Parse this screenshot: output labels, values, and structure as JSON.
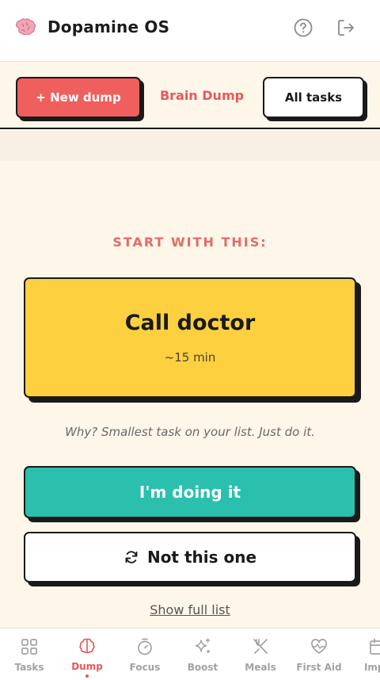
{
  "header": {
    "title": "Dopamine OS",
    "brand_icon": "brain-icon",
    "help_icon": "help-circle-icon",
    "logout_icon": "logout-icon"
  },
  "toolbar": {
    "new_dump_label": "+ New dump",
    "section_label": "Brain Dump",
    "all_tasks_label": "All tasks"
  },
  "main": {
    "prompt": "START WITH THIS:",
    "task": {
      "title": "Call doctor",
      "duration": "~15 min"
    },
    "reason": "Why? Smallest task on your list. Just do it.",
    "doing_label": "I'm doing it",
    "skip_label": "Not this one",
    "show_list_label": "Show full list"
  },
  "nav": {
    "items": [
      {
        "label": "Tasks",
        "icon": "grid-icon",
        "active": false
      },
      {
        "label": "Dump",
        "icon": "brain-icon",
        "active": true
      },
      {
        "label": "Focus",
        "icon": "timer-icon",
        "active": false
      },
      {
        "label": "Boost",
        "icon": "sparkle-icon",
        "active": false
      },
      {
        "label": "Meals",
        "icon": "utensils-icon",
        "active": false
      },
      {
        "label": "First Aid",
        "icon": "heart-pulse-icon",
        "active": false
      },
      {
        "label": "Impu",
        "icon": "calendar-icon",
        "active": false
      }
    ]
  },
  "colors": {
    "accent": "#ef5f5d",
    "card": "#fdd040",
    "primary_action": "#2bbfae",
    "background": "#fdf6e9"
  }
}
